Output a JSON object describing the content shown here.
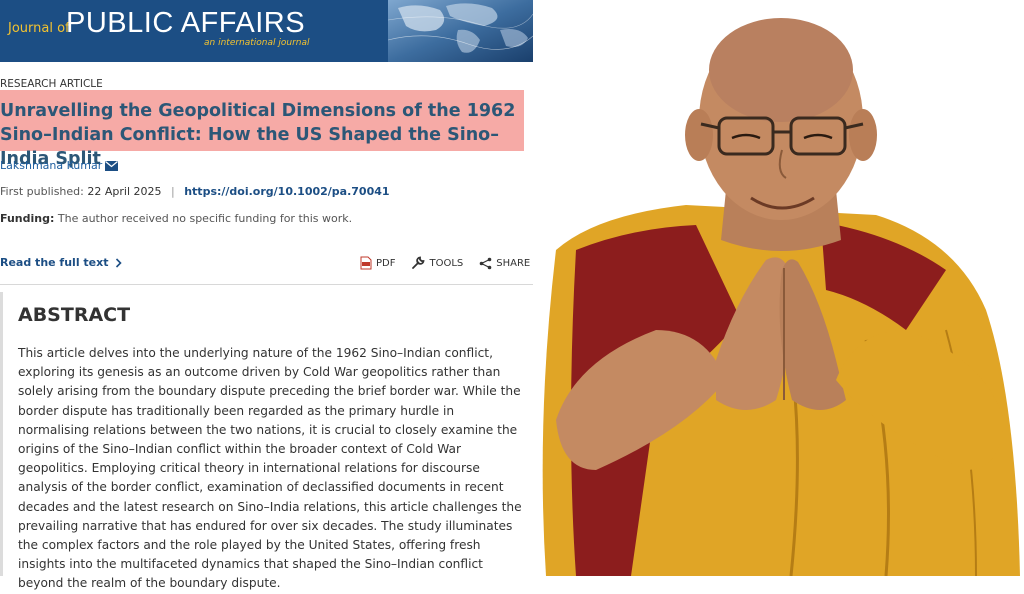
{
  "banner": {
    "journal_of": "Journal of",
    "journal_name": "PUBLIC AFFAIRS",
    "journal_subtitle": "an international journal"
  },
  "article": {
    "type": "RESEARCH ARTICLE",
    "title": "Unravelling the Geopolitical Dimensions of the 1962 Sino–Indian Conflict: How the US Shaped the Sino–India Split",
    "author": "Lakshmana Kumar",
    "first_published_label": "First published:",
    "first_published_date": "22 April 2025",
    "doi": "https://doi.org/10.1002/pa.70041",
    "funding_label": "Funding:",
    "funding_text": "The author received no specific funding for this work.",
    "read_full_text": "Read the full text"
  },
  "tools": {
    "pdf": "PDF",
    "tools": "TOOLS",
    "share": "SHARE"
  },
  "abstract": {
    "heading": "ABSTRACT",
    "text": "This article delves into the underlying nature of the 1962 Sino–Indian conflict, exploring its genesis as an outcome driven by Cold War geopolitics rather than solely arising from the boundary dispute preceding the brief border war. While the border dispute has traditionally been regarded as the primary hurdle in normalising relations between the two nations, it is crucial to closely examine the origins of the Sino–Indian conflict within the broader context of Cold War geopolitics. Employing critical theory in international relations for discourse analysis of the border conflict, examination of declassified documents in recent decades and the latest research on Sino–India relations, this article challenges the prevailing narrative that has endured for over six decades. The study illuminates the complex factors and the role played by the United States, offering fresh insights into the multifaceted dynamics that shaped the Sino–Indian conflict beyond the realm of the boundary dispute."
  },
  "icons": {
    "email": "envelope-icon",
    "chevron": "chevron-right-icon",
    "pdf": "pdf-icon",
    "tools": "wrench-icon",
    "share": "share-icon"
  },
  "colors": {
    "banner_bg": "#1c4e84",
    "banner_accent": "#f2c230",
    "title_highlight": "#f6aaa6",
    "title_text": "#2c5777",
    "link": "#1c4e84",
    "robe_yellow": "#e0a526",
    "robe_maroon": "#8c1d1d"
  }
}
